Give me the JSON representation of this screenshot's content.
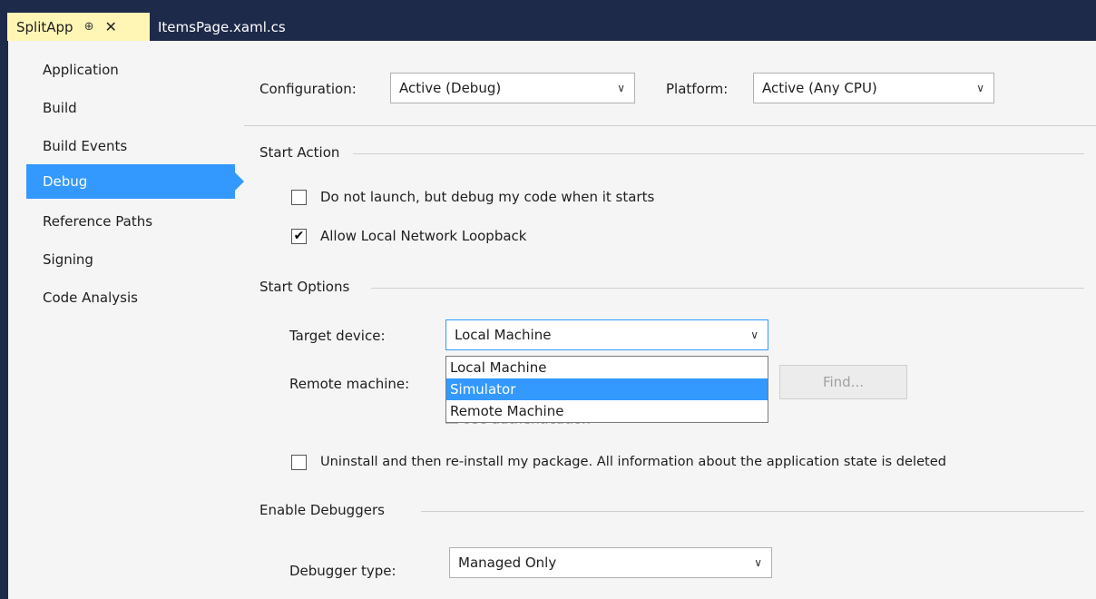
{
  "tabs": {
    "active": {
      "label": "SplitApp",
      "pin": "⊕",
      "close": "✕"
    },
    "second": {
      "label": "ItemsPage.xaml.cs"
    }
  },
  "sidebar": {
    "items": [
      {
        "label": "Application"
      },
      {
        "label": "Build"
      },
      {
        "label": "Build Events"
      },
      {
        "label": "Debug"
      },
      {
        "label": "Reference Paths"
      },
      {
        "label": "Signing"
      },
      {
        "label": "Code Analysis"
      }
    ]
  },
  "toolbar": {
    "configuration_label": "Configuration:",
    "configuration_value": "Active (Debug)",
    "platform_label": "Platform:",
    "platform_value": "Active (Any CPU)"
  },
  "start_action": {
    "title": "Start Action",
    "no_launch": {
      "label": "Do not launch, but debug my code when it starts",
      "checked": false
    },
    "loopback": {
      "label": "Allow Local Network Loopback",
      "checked": true
    }
  },
  "start_options": {
    "title": "Start Options",
    "target_label": "Target device:",
    "target_value": "Local Machine",
    "remote_label": "Remote machine:",
    "find_label": "Find...",
    "auth_label": "Use authentication",
    "dropdown_options": [
      "Local Machine",
      "Simulator",
      "Remote Machine"
    ],
    "highlighted_option": "Simulator",
    "reinstall": {
      "label": "Uninstall and then re-install my package. All information about the application state is deleted",
      "checked": false
    }
  },
  "debuggers": {
    "title": "Enable Debuggers",
    "type_label": "Debugger type:",
    "type_value": "Managed Only"
  },
  "colors": {
    "selection": "#3399ff",
    "active_tab": "#fff6b5",
    "frame": "#1e2a4a"
  }
}
